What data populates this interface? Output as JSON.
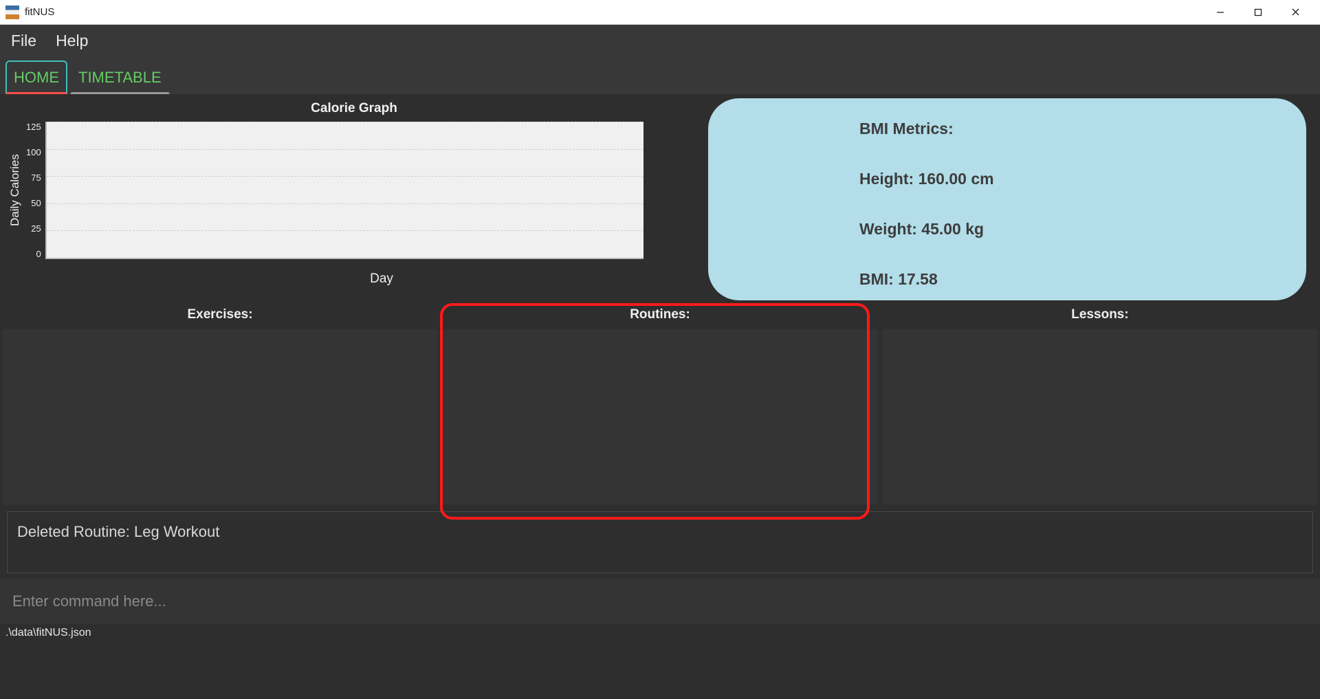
{
  "window": {
    "title": "fitNUS"
  },
  "menu": {
    "file": "File",
    "help": "Help"
  },
  "tabs": {
    "home": "HOME",
    "timetable": "TIMETABLE"
  },
  "chart": {
    "title": "Calorie Graph",
    "ylabel": "Daily Calories",
    "xlabel": "Day"
  },
  "chart_data": {
    "type": "bar",
    "categories": [],
    "values": [],
    "title": "Calorie Graph",
    "xlabel": "Day",
    "ylabel": "Daily Calories",
    "ylim": [
      0,
      125
    ],
    "yticks": [
      0,
      25,
      50,
      75,
      100,
      125
    ]
  },
  "bmi": {
    "title": "BMI Metrics:",
    "height": "Height: 160.00 cm",
    "weight": "Weight: 45.00 kg",
    "bmi": "BMI: 17.58"
  },
  "lists": {
    "exercises_header": "Exercises:",
    "routines_header": "Routines:",
    "lessons_header": "Lessons:"
  },
  "message": "Deleted Routine: Leg Workout",
  "command": {
    "placeholder": "Enter command here..."
  },
  "status": ".\\data\\fitNUS.json"
}
